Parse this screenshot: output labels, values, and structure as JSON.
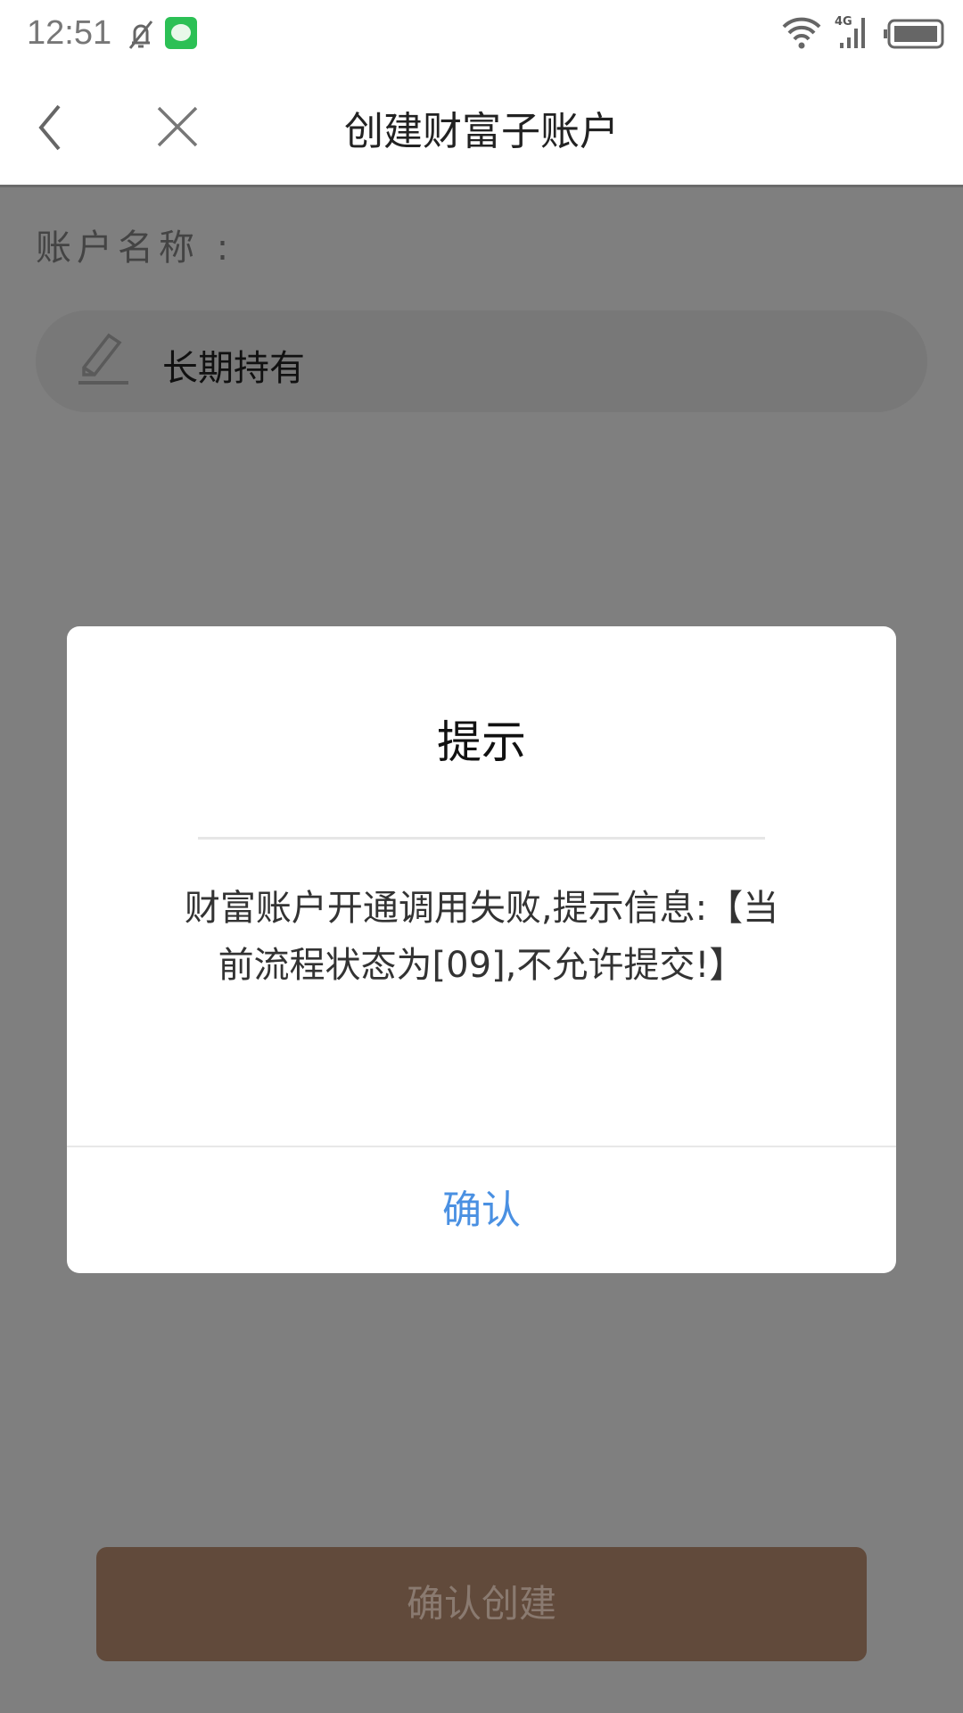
{
  "status_bar": {
    "time": "12:51",
    "network": "4G"
  },
  "header": {
    "title": "创建财富子账户"
  },
  "form": {
    "label": "账户名称 :",
    "account_name": "长期持有"
  },
  "dialog": {
    "title": "提示",
    "message": "财富账户开通调用失败,提示信息:【当前流程状态为[09],不允许提交!】",
    "confirm": "确认"
  },
  "footer": {
    "create_button": "确认创建"
  },
  "colors": {
    "accent": "#4a90e2",
    "create_button": "#614a3b"
  }
}
